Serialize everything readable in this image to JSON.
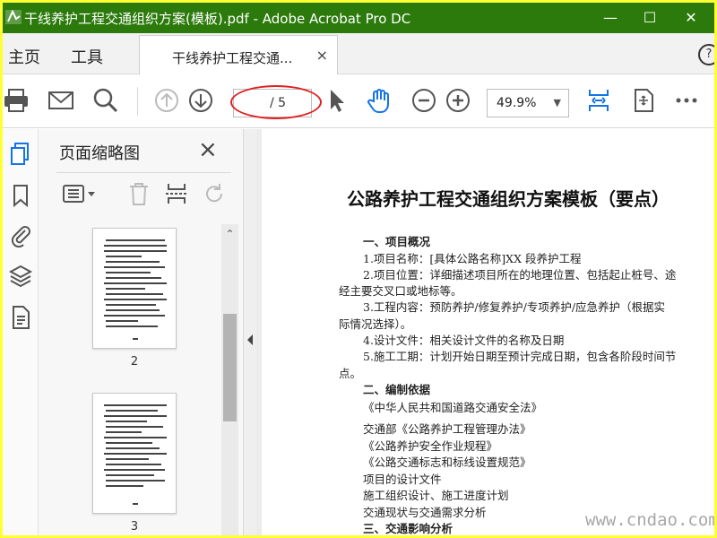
{
  "window": {
    "title": "干线养护工程交通组织方案(模板).pdf - Adobe Acrobat Pro DC",
    "minimize": "—",
    "maximize": "☐",
    "close": "✕",
    "titlebar_color": "#2b7a0b",
    "frame_color": "#ffff33"
  },
  "tabs": {
    "home": "主页",
    "tools": "工具",
    "document_tab": "干线养护工程交通...",
    "close": "×",
    "help": "?"
  },
  "toolbar": {
    "page_current": "",
    "page_total": "/ 5",
    "zoom": "49.9%",
    "zoom_caret": "▼",
    "icons": [
      "print-icon",
      "email-icon",
      "search-icon",
      "previous-page-icon",
      "next-page-icon",
      "select-cursor-icon",
      "hand-tool-icon",
      "zoom-out-icon",
      "zoom-in-icon",
      "fit-page-icon",
      "full-screen-icon",
      "more-icon"
    ],
    "highlight_color": "#e02020",
    "accent_color": "#1473e6"
  },
  "rail": {
    "icons": [
      "page-thumbnails-icon",
      "bookmarks-icon",
      "attachments-icon",
      "layers-icon",
      "document-properties-icon"
    ]
  },
  "panel": {
    "title": "页面缩略图",
    "close": "×",
    "icons": [
      "thumbnail-options-icon",
      "delete-page-icon",
      "extract-page-icon",
      "rotate-page-icon"
    ],
    "thumbnails": [
      {
        "page": "2"
      },
      {
        "page": "3"
      }
    ],
    "scroll_up": "⌃"
  },
  "document": {
    "heading": "公路养护工程交通组织方案模板（要点）",
    "lines": [
      {
        "text": "一、项目概况",
        "section": true
      },
      {
        "text": "1.项目名称：[具体公路名称]XX 段养护工程",
        "section": false
      },
      {
        "text": "2.项目位置：详细描述项目所在的地理位置、包括起止桩号、途",
        "section": false
      },
      {
        "text": "经主要交叉口或地标等。",
        "section": false
      },
      {
        "text": "3.工程内容：预防养护/修复养护/专项养护/应急养护（根据实",
        "section": false
      },
      {
        "text": "际情况选择）。",
        "section": false
      },
      {
        "text": "4.设计文件：相关设计文件的名称及日期",
        "section": false
      },
      {
        "text": "5.施工工期：计划开始日期至预计完成日期，包含各阶段时间节",
        "section": false
      },
      {
        "text": "点。",
        "section": false
      },
      {
        "text": "二、编制依据",
        "section": true
      },
      {
        "text": "《中华人民共和国道路交通安全法》",
        "section": false
      },
      {
        "text": "交通部《公路养护工程管理办法》",
        "section": false
      },
      {
        "text": "《公路养护安全作业规程》",
        "section": false
      },
      {
        "text": "《公路交通标志和标线设置规范》",
        "section": false
      },
      {
        "text": "项目的设计文件",
        "section": false
      },
      {
        "text": "施工组织设计、施工进度计划",
        "section": false
      },
      {
        "text": "交通现状与交通需求分析",
        "section": false
      },
      {
        "text": "三、交通影响分析",
        "section": true
      }
    ]
  },
  "watermark": "www.cndao.com"
}
